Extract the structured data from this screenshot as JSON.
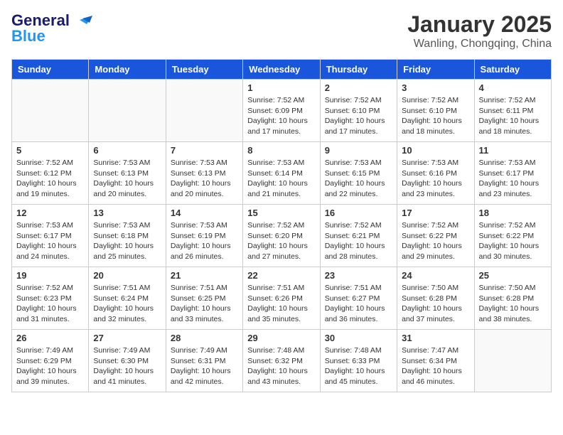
{
  "header": {
    "logo_line1": "General",
    "logo_line2": "Blue",
    "month": "January 2025",
    "location": "Wanling, Chongqing, China"
  },
  "days_of_week": [
    "Sunday",
    "Monday",
    "Tuesday",
    "Wednesday",
    "Thursday",
    "Friday",
    "Saturday"
  ],
  "weeks": [
    [
      {
        "day": "",
        "info": ""
      },
      {
        "day": "",
        "info": ""
      },
      {
        "day": "",
        "info": ""
      },
      {
        "day": "1",
        "info": "Sunrise: 7:52 AM\nSunset: 6:09 PM\nDaylight: 10 hours and 17 minutes."
      },
      {
        "day": "2",
        "info": "Sunrise: 7:52 AM\nSunset: 6:10 PM\nDaylight: 10 hours and 17 minutes."
      },
      {
        "day": "3",
        "info": "Sunrise: 7:52 AM\nSunset: 6:10 PM\nDaylight: 10 hours and 18 minutes."
      },
      {
        "day": "4",
        "info": "Sunrise: 7:52 AM\nSunset: 6:11 PM\nDaylight: 10 hours and 18 minutes."
      }
    ],
    [
      {
        "day": "5",
        "info": "Sunrise: 7:52 AM\nSunset: 6:12 PM\nDaylight: 10 hours and 19 minutes."
      },
      {
        "day": "6",
        "info": "Sunrise: 7:53 AM\nSunset: 6:13 PM\nDaylight: 10 hours and 20 minutes."
      },
      {
        "day": "7",
        "info": "Sunrise: 7:53 AM\nSunset: 6:13 PM\nDaylight: 10 hours and 20 minutes."
      },
      {
        "day": "8",
        "info": "Sunrise: 7:53 AM\nSunset: 6:14 PM\nDaylight: 10 hours and 21 minutes."
      },
      {
        "day": "9",
        "info": "Sunrise: 7:53 AM\nSunset: 6:15 PM\nDaylight: 10 hours and 22 minutes."
      },
      {
        "day": "10",
        "info": "Sunrise: 7:53 AM\nSunset: 6:16 PM\nDaylight: 10 hours and 23 minutes."
      },
      {
        "day": "11",
        "info": "Sunrise: 7:53 AM\nSunset: 6:17 PM\nDaylight: 10 hours and 23 minutes."
      }
    ],
    [
      {
        "day": "12",
        "info": "Sunrise: 7:53 AM\nSunset: 6:17 PM\nDaylight: 10 hours and 24 minutes."
      },
      {
        "day": "13",
        "info": "Sunrise: 7:53 AM\nSunset: 6:18 PM\nDaylight: 10 hours and 25 minutes."
      },
      {
        "day": "14",
        "info": "Sunrise: 7:53 AM\nSunset: 6:19 PM\nDaylight: 10 hours and 26 minutes."
      },
      {
        "day": "15",
        "info": "Sunrise: 7:52 AM\nSunset: 6:20 PM\nDaylight: 10 hours and 27 minutes."
      },
      {
        "day": "16",
        "info": "Sunrise: 7:52 AM\nSunset: 6:21 PM\nDaylight: 10 hours and 28 minutes."
      },
      {
        "day": "17",
        "info": "Sunrise: 7:52 AM\nSunset: 6:22 PM\nDaylight: 10 hours and 29 minutes."
      },
      {
        "day": "18",
        "info": "Sunrise: 7:52 AM\nSunset: 6:22 PM\nDaylight: 10 hours and 30 minutes."
      }
    ],
    [
      {
        "day": "19",
        "info": "Sunrise: 7:52 AM\nSunset: 6:23 PM\nDaylight: 10 hours and 31 minutes."
      },
      {
        "day": "20",
        "info": "Sunrise: 7:51 AM\nSunset: 6:24 PM\nDaylight: 10 hours and 32 minutes."
      },
      {
        "day": "21",
        "info": "Sunrise: 7:51 AM\nSunset: 6:25 PM\nDaylight: 10 hours and 33 minutes."
      },
      {
        "day": "22",
        "info": "Sunrise: 7:51 AM\nSunset: 6:26 PM\nDaylight: 10 hours and 35 minutes."
      },
      {
        "day": "23",
        "info": "Sunrise: 7:51 AM\nSunset: 6:27 PM\nDaylight: 10 hours and 36 minutes."
      },
      {
        "day": "24",
        "info": "Sunrise: 7:50 AM\nSunset: 6:28 PM\nDaylight: 10 hours and 37 minutes."
      },
      {
        "day": "25",
        "info": "Sunrise: 7:50 AM\nSunset: 6:28 PM\nDaylight: 10 hours and 38 minutes."
      }
    ],
    [
      {
        "day": "26",
        "info": "Sunrise: 7:49 AM\nSunset: 6:29 PM\nDaylight: 10 hours and 39 minutes."
      },
      {
        "day": "27",
        "info": "Sunrise: 7:49 AM\nSunset: 6:30 PM\nDaylight: 10 hours and 41 minutes."
      },
      {
        "day": "28",
        "info": "Sunrise: 7:49 AM\nSunset: 6:31 PM\nDaylight: 10 hours and 42 minutes."
      },
      {
        "day": "29",
        "info": "Sunrise: 7:48 AM\nSunset: 6:32 PM\nDaylight: 10 hours and 43 minutes."
      },
      {
        "day": "30",
        "info": "Sunrise: 7:48 AM\nSunset: 6:33 PM\nDaylight: 10 hours and 45 minutes."
      },
      {
        "day": "31",
        "info": "Sunrise: 7:47 AM\nSunset: 6:34 PM\nDaylight: 10 hours and 46 minutes."
      },
      {
        "day": "",
        "info": ""
      }
    ]
  ]
}
